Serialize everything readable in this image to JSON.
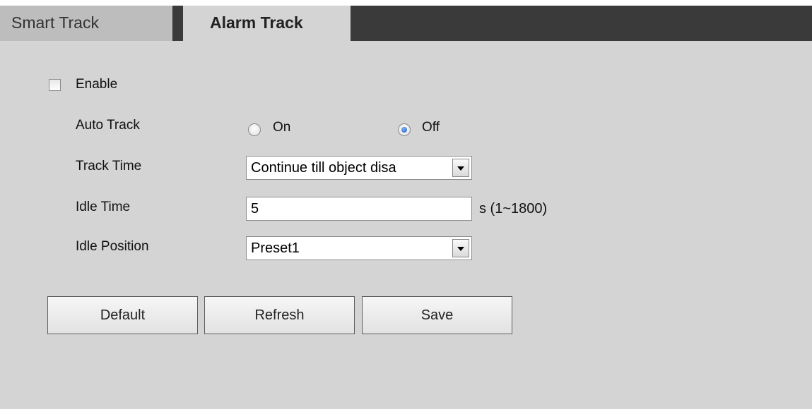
{
  "tabs": {
    "smart_track": "Smart Track",
    "alarm_track": "Alarm Track"
  },
  "enable": {
    "label": "Enable",
    "checked": false
  },
  "auto_track": {
    "label": "Auto Track",
    "options": [
      "On",
      "Off"
    ],
    "selected": "Off"
  },
  "track_time": {
    "label": "Track Time",
    "value": "Continue till object disa"
  },
  "idle_time": {
    "label": "Idle Time",
    "value": "5",
    "unit": "s (1~1800)"
  },
  "idle_position": {
    "label": "Idle Position",
    "value": "Preset1"
  },
  "buttons": {
    "default": "Default",
    "refresh": "Refresh",
    "save": "Save"
  },
  "colors": {
    "panel_bg": "#d4d4d4",
    "tabbar_bg": "#3a3a3a",
    "inactive_tab_bg": "#bdbdbd",
    "radio_selected": "#1a5fbf"
  }
}
